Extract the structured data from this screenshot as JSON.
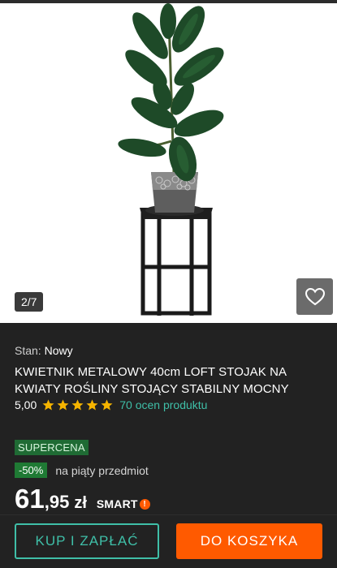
{
  "gallery": {
    "counter": "2/7",
    "image": "plant-on-metal-stand-photo",
    "favorite_icon": "heart-outline-icon"
  },
  "product": {
    "condition_label": "Stan:",
    "condition_value": "Nowy",
    "title": "KWIETNIK METALOWY 40cm LOFT STOJAK NA KWIATY ROŚLINY STOJĄCY STABILNY MOCNY",
    "rating_value": "5,00",
    "rating_stars": 5,
    "reviews_text": "70 ocen produktu",
    "badge_supercena": "SUPERCENA",
    "discount_badge": "-50%",
    "discount_text": "na piąty przedmiot",
    "price_int": "61",
    "price_dec": ",95",
    "currency": "zł",
    "smart_label": "SMART",
    "smart_mark": "!"
  },
  "actions": {
    "buy_now": "KUP I ZAPŁAĆ",
    "add_to_cart": "DO KOSZYKA"
  },
  "colors": {
    "accent_teal": "#3fbfa8",
    "accent_orange": "#ff5a00",
    "star_yellow": "#f5b400",
    "supercena_green": "#1f6b34"
  }
}
